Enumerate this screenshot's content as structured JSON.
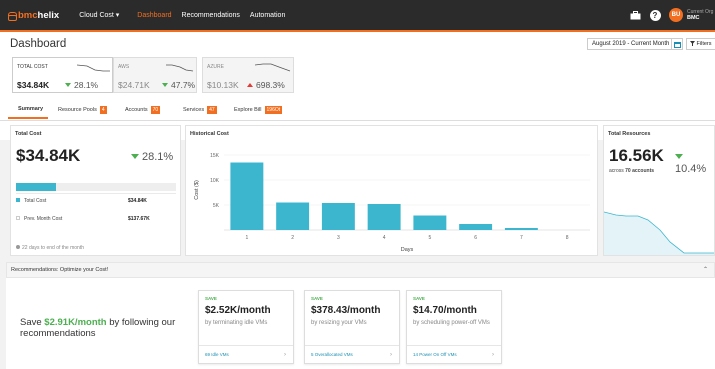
{
  "brand": {
    "prefix": "bmc",
    "name": "helix"
  },
  "nav": [
    {
      "label": "Cloud Cost ▾"
    },
    {
      "label": "Dashboard"
    },
    {
      "label": "Recommendations"
    },
    {
      "label": "Automation"
    }
  ],
  "user": {
    "initials": "BU",
    "org_label": "Current Org",
    "org_name": "BMC"
  },
  "page": {
    "title": "Dashboard"
  },
  "toolbar": {
    "date_range": "August 2019 - Current Month",
    "filters_label": "Filters"
  },
  "kpis": [
    {
      "label": "TOTAL COST",
      "value": "$34.84K",
      "change": "28.1%",
      "direction": "down"
    },
    {
      "label": "AWS",
      "value": "$24.71K",
      "change": "47.7%",
      "direction": "down"
    },
    {
      "label": "AZURE",
      "value": "$10.13K",
      "change": "698.3%",
      "direction": "up"
    }
  ],
  "tabs": [
    {
      "label": "Summary"
    },
    {
      "label": "Resource Pools",
      "badge": "4"
    },
    {
      "label": "Accounts",
      "badge": "70"
    },
    {
      "label": "Services",
      "badge": "47"
    },
    {
      "label": "Explore Bill",
      "badge": "196Ot"
    }
  ],
  "total_cost_card": {
    "title": "Total Cost",
    "value": "$34.84K",
    "change": "28.1%",
    "bar_fraction": 0.25,
    "rows": [
      {
        "label": "Total Cost",
        "amount": "$34.84K"
      },
      {
        "label": "Prev. Month Cost",
        "amount": "$137.67K"
      }
    ],
    "footer": "22 days to end of the month"
  },
  "historical": {
    "title": "Historical Cost"
  },
  "chart_data": {
    "type": "bar",
    "title": "Historical Cost",
    "xlabel": "Days",
    "ylabel": "Cost ($)",
    "categories": [
      "1",
      "2",
      "3",
      "4",
      "5",
      "6",
      "7",
      "8"
    ],
    "values": [
      13500,
      5500,
      5400,
      5200,
      2900,
      1200,
      400,
      0
    ],
    "yticks": [
      "5K",
      "10K",
      "15K"
    ],
    "ylim": [
      0,
      16000
    ],
    "color": "#3cb6cf"
  },
  "total_resources": {
    "title": "Total Resources",
    "value": "16.56K",
    "change": "10.4%",
    "subtitle_prefix": "across",
    "subtitle_count": "70 accounts"
  },
  "recommendations": {
    "bar_title": "Recommendations: Optimize your Cost!",
    "save_prefix": "Save ",
    "save_amount": "$2.91K/month",
    "save_suffix": " by following our recommendations",
    "cards": [
      {
        "save": "SAVE",
        "amount": "$2.52K/month",
        "desc": "by terminating idle VMs",
        "link": "69 Idle VMs"
      },
      {
        "save": "SAVE",
        "amount": "$378.43/month",
        "desc": "by resizing your VMs",
        "link": "5 Overallocated VMs"
      },
      {
        "save": "SAVE",
        "amount": "$14.70/month",
        "desc": "by scheduling power-off VMs",
        "link": "14 Power On Off VMs"
      }
    ]
  }
}
